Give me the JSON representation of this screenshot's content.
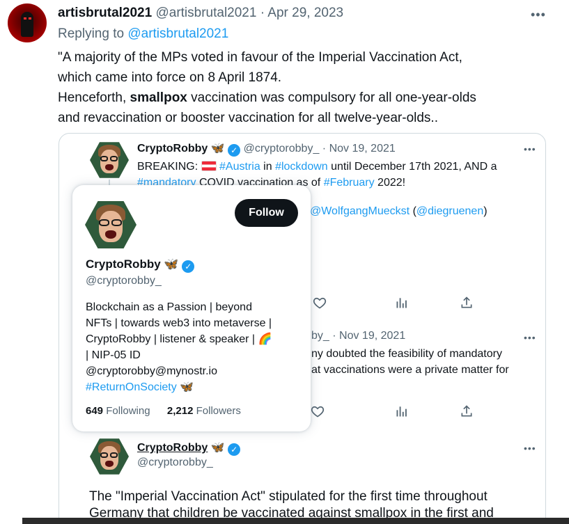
{
  "main_tweet": {
    "display_name": "artisbrutal2021",
    "handle": "@artisbrutal2021",
    "separator": "·",
    "date": "Apr 29, 2023",
    "replying_to_label": "Replying to",
    "replying_to_handle": "@artisbrutal2021",
    "line1": "\"A majority of the MPs voted in favour of the Imperial Vaccination Act,",
    "line2": "which came into force on 8 April 1874.",
    "line3_start": "Henceforth, ",
    "line3_bold": "smallpox",
    "line3_end": " vaccination was compulsory for all one-year-olds",
    "line4": "and revaccination or booster vaccination for all twelve-year-olds.."
  },
  "quote1": {
    "display_name": "CryptoRobby",
    "butterfly": "🦋",
    "handle": "@cryptorobby_",
    "separator": "·",
    "date": "Nov 19, 2021",
    "l1_a": "BREAKING: ",
    "l1_tag1": "#Austria",
    "l1_b": " in ",
    "l1_tag2": "#lockdown",
    "l1_c": " until December 17th 2021, AND a",
    "l2_tag1": "#mandatory",
    "l2_b": " COVID vaccination as of ",
    "l2_tag2": "#February",
    "l2_c": " 2022!",
    "l3_mention1": "@WolfgangMueckst",
    "l3_open": " (",
    "l3_mention2": "@diegruenen",
    "l3_close": ")"
  },
  "quote2": {
    "handle_partial": "by_",
    "separator": "·",
    "date": "Nov 19, 2021",
    "l1": "ny doubted the feasibility of mandatory",
    "l2": "at vaccinations were a private matter for"
  },
  "quote3": {
    "display_name": "CryptoRobby",
    "butterfly": "🦋",
    "handle": "@cryptorobby_",
    "l1": "The \"Imperial Vaccination Act\" stipulated for the first time throughout",
    "l2": "Germany that children be vaccinated against smallpox in the first and"
  },
  "hover_card": {
    "follow_label": "Follow",
    "display_name": "CryptoRobby",
    "butterfly": "🦋",
    "handle": "@cryptorobby_",
    "bio_l1": "Blockchain as a Passion | beyond",
    "bio_l2": "NFTs | towards web3 into metaverse |",
    "bio_l3": "CryptoRobby | listener & speaker | ",
    "rainbow": "🌈",
    "bio_l4": "| NIP-05 ID",
    "bio_l5": "@cryptorobby@mynostr.io",
    "bio_tag": "#ReturnOnSociety",
    "bio_butterfly": "🦋",
    "following_count": "649",
    "following_label": "Following",
    "followers_count": "2,212",
    "followers_label": "Followers"
  },
  "icons": {
    "more": "more-icon",
    "like": "heart-icon",
    "views": "analytics-icon",
    "share": "share-icon",
    "verified": "verified-badge-icon"
  },
  "colors": {
    "link": "#1d9bf0",
    "text": "#0f1419",
    "muted": "#536471",
    "border": "#cfd9de"
  }
}
